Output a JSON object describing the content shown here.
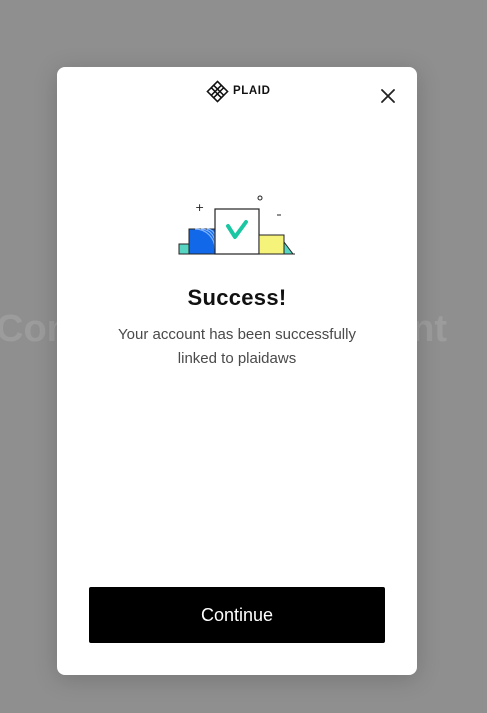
{
  "background": {
    "text_left": "Con",
    "text_right": "unt"
  },
  "brand": {
    "name": "PLAID",
    "logo_icon": "plaid-logo-icon"
  },
  "modal": {
    "close_icon": "close-icon",
    "title": "Success!",
    "message": "Your account has been successfully linked to plaidaws",
    "continue_label": "Continue"
  },
  "illustration": {
    "icon": "success-checkmark-illustration",
    "check_color": "#1bc7a3",
    "blue_color": "#1169ea",
    "yellow_color": "#f6f37b"
  },
  "colors": {
    "overlay": "#8f8f8f",
    "button_bg": "#000000",
    "button_text": "#ffffff",
    "title_text": "#111111",
    "body_text": "#4a4a4a"
  }
}
